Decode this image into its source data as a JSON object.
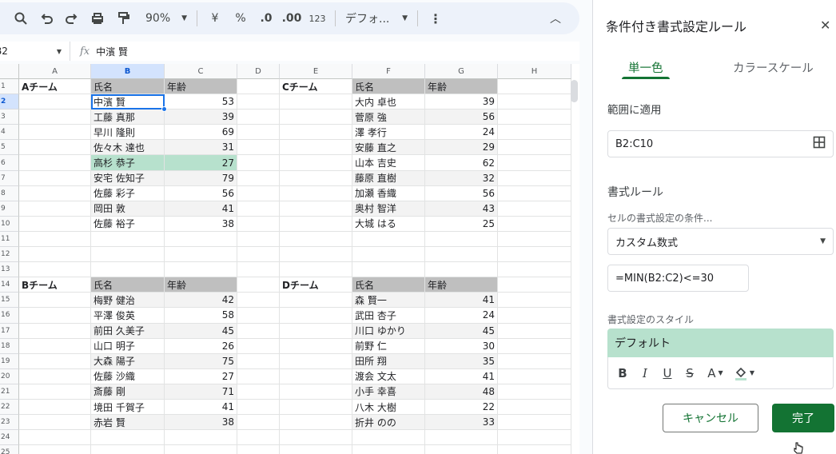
{
  "toolbar": {
    "zoom": "90%",
    "currency": "¥",
    "percent": "%",
    "dec_decrease": ".0",
    "dec_increase": ".00",
    "number_format": "123",
    "font": "デフォ..."
  },
  "formula_bar": {
    "cell_ref": "B2",
    "content": "中濱 賢"
  },
  "grid": {
    "columns": [
      "A",
      "B",
      "C",
      "D",
      "E",
      "F",
      "G",
      "H"
    ],
    "selected_column": "B",
    "selected_row": "2",
    "rows": [
      {
        "n": "1",
        "a": "Aチーム",
        "b": "氏名",
        "c": "年齢",
        "e": "Cチーム",
        "f": "氏名",
        "g": "年齢"
      },
      {
        "n": "2",
        "b": "中濱 賢",
        "c": "53",
        "f": "大内 卓也",
        "g": "39"
      },
      {
        "n": "3",
        "b": "工藤 真那",
        "c": "39",
        "f": "菅原 強",
        "g": "56"
      },
      {
        "n": "4",
        "b": "早川 隆則",
        "c": "69",
        "f": "澤 孝行",
        "g": "24"
      },
      {
        "n": "5",
        "b": "佐々木 達也",
        "c": "31",
        "f": "安藤 直之",
        "g": "29"
      },
      {
        "n": "6",
        "b": "高杉 恭子",
        "c": "27",
        "f": "山本 吉史",
        "g": "62"
      },
      {
        "n": "7",
        "b": "安宅 佐知子",
        "c": "79",
        "f": "藤原 直樹",
        "g": "32"
      },
      {
        "n": "8",
        "b": "佐藤 彩子",
        "c": "56",
        "f": "加瀬 香織",
        "g": "56"
      },
      {
        "n": "9",
        "b": "岡田 敦",
        "c": "41",
        "f": "奥村 智洋",
        "g": "43"
      },
      {
        "n": "10",
        "b": "佐藤 裕子",
        "c": "38",
        "f": "大城 はる",
        "g": "25"
      },
      {
        "n": "11"
      },
      {
        "n": "12"
      },
      {
        "n": "13"
      },
      {
        "n": "14",
        "a": "Bチーム",
        "b": "氏名",
        "c": "年齢",
        "e": "Dチーム",
        "f": "氏名",
        "g": "年齢"
      },
      {
        "n": "15",
        "b": "梅野 健治",
        "c": "42",
        "f": "森 賢一",
        "g": "41"
      },
      {
        "n": "16",
        "b": "平澤 俊英",
        "c": "58",
        "f": "武田 杏子",
        "g": "24"
      },
      {
        "n": "17",
        "b": "前田 久美子",
        "c": "45",
        "f": "川口 ゆかり",
        "g": "45"
      },
      {
        "n": "18",
        "b": "山口 明子",
        "c": "26",
        "f": "前野 仁",
        "g": "30"
      },
      {
        "n": "19",
        "b": "大森 陽子",
        "c": "75",
        "f": "田所 翔",
        "g": "35"
      },
      {
        "n": "20",
        "b": "佐藤 沙織",
        "c": "27",
        "f": "渡会 文太",
        "g": "41"
      },
      {
        "n": "21",
        "b": "斎藤 剛",
        "c": "71",
        "f": "小手 幸喜",
        "g": "48"
      },
      {
        "n": "22",
        "b": "境田 千賀子",
        "c": "41",
        "f": "八木 大樹",
        "g": "22"
      },
      {
        "n": "23",
        "b": "赤岩 賢",
        "c": "38",
        "f": "折井 のの",
        "g": "33"
      },
      {
        "n": "24"
      },
      {
        "n": "25"
      }
    ]
  },
  "panel": {
    "title": "条件付き書式設定ルール",
    "tab_single": "単一色",
    "tab_scale": "カラースケール",
    "range_label": "範囲に適用",
    "range_value": "B2:C10",
    "rules_label": "書式ルール",
    "condition_label": "セルの書式設定の条件...",
    "condition_value": "カスタム数式",
    "formula_value": "=MIN(B2:C2)<=30",
    "style_label": "書式設定のスタイル",
    "style_preview": "デフォルト",
    "cancel": "キャンセル",
    "done": "完了",
    "highlight_color": "#b7e1cd",
    "accent_color": "#137333"
  }
}
